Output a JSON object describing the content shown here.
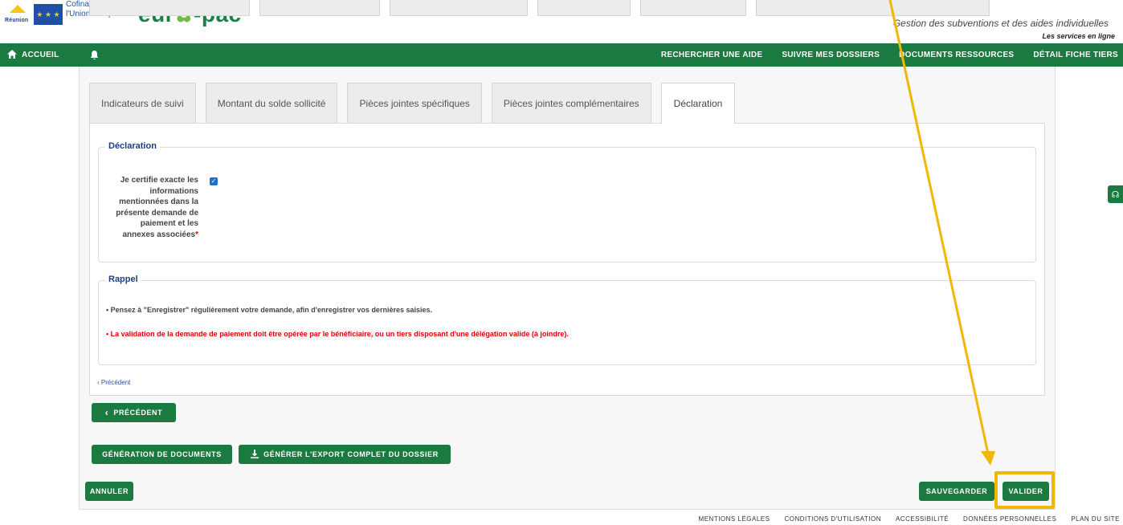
{
  "header": {
    "eu_text_line1": "Cofinancé par",
    "eu_text_line2": "l'Union européenne",
    "reunion_label": "Réunion",
    "brand": "eur",
    "brand_tail": "-pac",
    "tagline": "Gestion des subventions et des aides individuelles",
    "subtagline": "Les services en ligne"
  },
  "nav": {
    "home": "ACCUEIL",
    "items": [
      "RECHERCHER UNE AIDE",
      "SUIVRE MES DOSSIERS",
      "DOCUMENTS RESSOURCES",
      "DÉTAIL FICHE TIERS"
    ]
  },
  "tabs": [
    "Indicateurs de suivi",
    "Montant du solde sollicité",
    "Pièces jointes spécifiques",
    "Pièces jointes complémentaires",
    "Déclaration"
  ],
  "active_tab": "Déclaration",
  "declaration": {
    "legend": "Déclaration",
    "cert_label": "Je certifie exacte les informations mentionnées dans la présente demande de paiement et les annexes associées",
    "required_mark": "*",
    "checked": true
  },
  "rappel": {
    "legend": "Rappel",
    "line1": "• Pensez à \"Enregistrer\" régulièrement votre demande, afin d'enregistrer vos dernières saisies.",
    "line2": "• La validation de la demande de paiement doit être opérée par le bénéficiaire, ou un tiers disposant d'une délégation valide (à joindre)."
  },
  "prev_link": "Précédent",
  "buttons": {
    "precedent": "PRÉCÉDENT",
    "generation": "GÉNÉRATION DE DOCUMENTS",
    "export": "GÉNÉRER L'EXPORT COMPLET DU DOSSIER",
    "annuler": "ANNULER",
    "sauvegarder": "SAUVEGARDER",
    "valider": "VALIDER"
  },
  "footer": [
    "MENTIONS LÉGALES",
    "CONDITIONS D'UTILISATION",
    "ACCESSIBILITÉ",
    "DONNÉES PERSONNELLES",
    "PLAN DU SITE"
  ],
  "colors": {
    "primary_green": "#1b7a3f",
    "highlight": "#f2b705",
    "warning_red": "#e00000",
    "legend_blue": "#1f3f7a"
  }
}
